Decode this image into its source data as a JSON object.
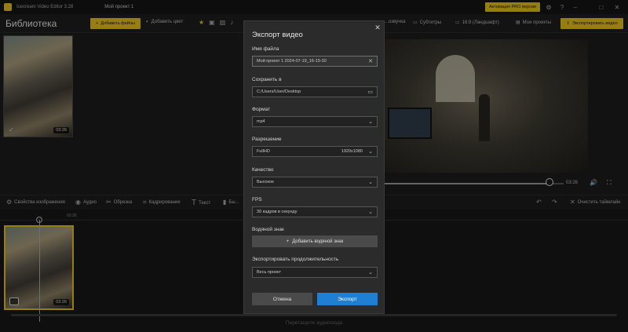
{
  "titlebar": {
    "app_name": "Icecream Video Editor 3.28",
    "project_name": "Мой проект 1",
    "pro_label": "Активация PRO версии"
  },
  "toolbar": {
    "library_title": "Библиотека",
    "add_files_label": "Добавить файлы",
    "add_color_label": "Добавить цвет",
    "voiceover_label": "...озвучка",
    "subtitles_label": "Субтитры",
    "aspect_label": "16:9 (Ландшафт)",
    "my_projects_label": "Мои проекты",
    "export_label": "Экспортировать видео"
  },
  "library": {
    "thumb_duration": "03:26"
  },
  "player": {
    "time": "03:26",
    "progress": 0.92
  },
  "edit_tools": {
    "image_props": "Свойства изображения",
    "audio": "Аудио",
    "trim": "Обрезка",
    "crop": "Кадрирование",
    "text": "Текст",
    "more": "Бы...",
    "clear_timeline": "Очистить таймлайн"
  },
  "timeline": {
    "ruler_mark": "03:26",
    "clip_duration": "03:26",
    "add_audio_hint": "Перетащите аудиосюда"
  },
  "dialog": {
    "title": "Экспорт видео",
    "filename_label": "Имя файла",
    "filename_value": "Мой проект 1 2024-07-19_16-19-30",
    "save_to_label": "Сохранить в",
    "save_to_value": "C:/Users/User/Desktop",
    "format_label": "Формат",
    "format_value": "mp4",
    "resolution_label": "Разрешение",
    "resolution_value": "FullHD",
    "resolution_size": "1920x1080",
    "quality_label": "Качество",
    "quality_value": "Высокое",
    "fps_label": "FPS",
    "fps_value": "30 кадров в секунду",
    "watermark_label": "Водяной знак",
    "watermark_button": "Добавить водяной знак",
    "duration_label": "Экспортировать продолжительность",
    "duration_value": "Весь проект",
    "cancel_label": "Отмена",
    "export_label": "Экспорт"
  },
  "colors": {
    "accent": "#e8c21a",
    "primary_button": "#1f7fd3"
  }
}
